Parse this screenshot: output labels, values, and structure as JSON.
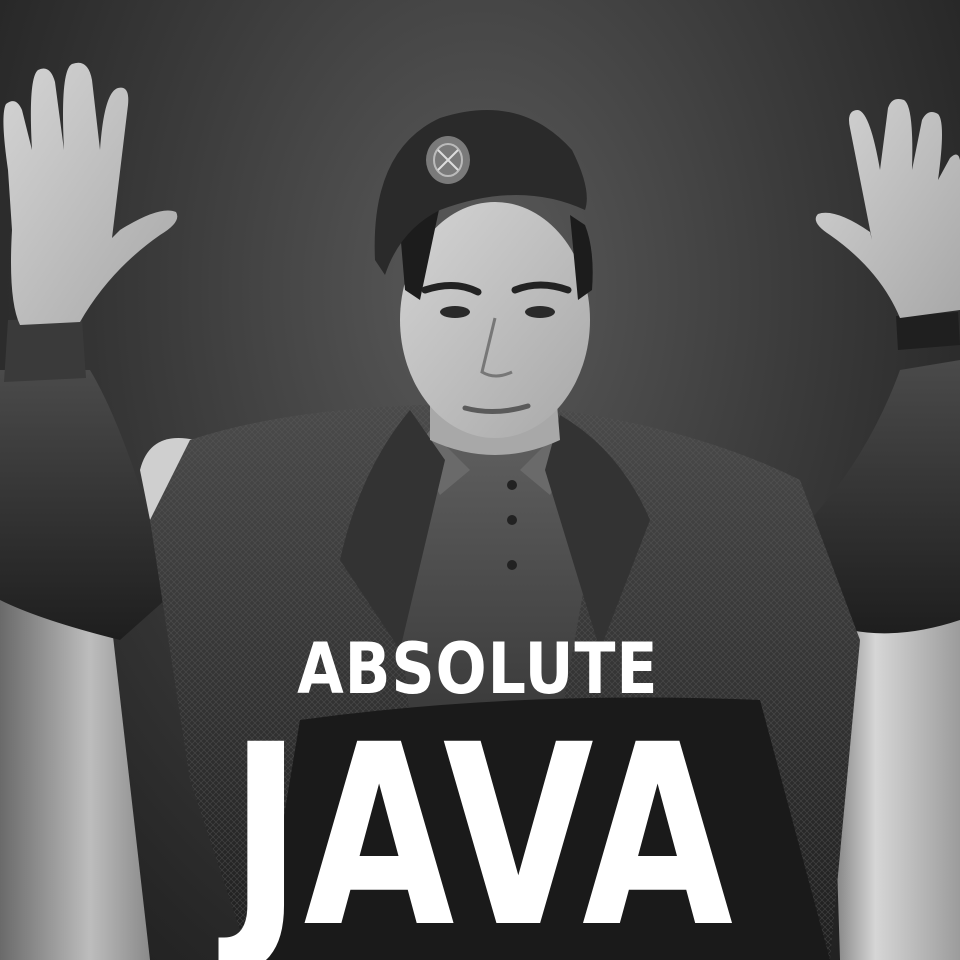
{
  "meme": {
    "caption_top": "ABSOLUTE",
    "caption_bottom": "JAVA"
  },
  "colors": {
    "caption": "#ffffff",
    "background": "#2b2b2b"
  }
}
